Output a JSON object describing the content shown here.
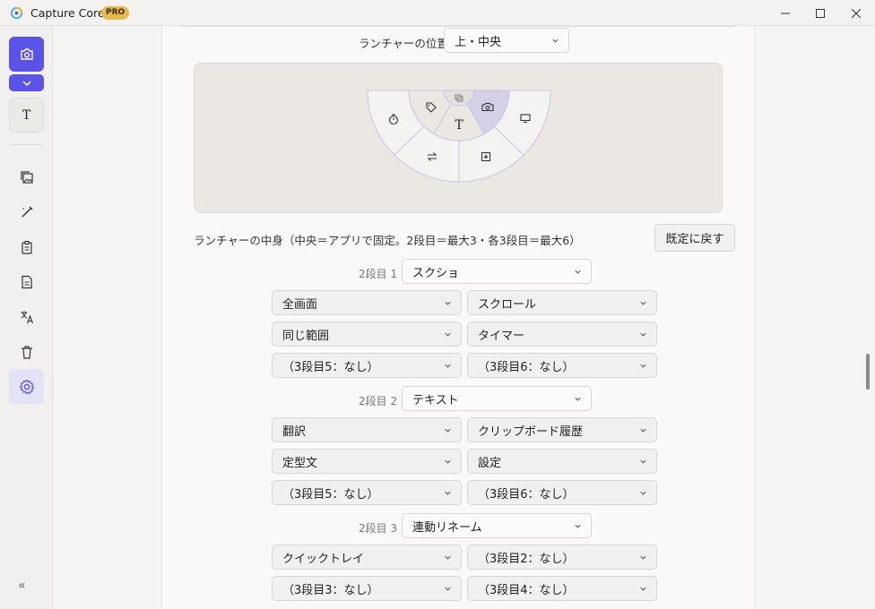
{
  "window": {
    "title": "Capture Core",
    "badge": "PRO",
    "controls": {
      "minimize": "—",
      "maximize": "☐",
      "close": "✕"
    }
  },
  "sidebar": {
    "primary_icon": "camera-icon",
    "text_tool_label": "T",
    "items": [
      {
        "name": "image-gallery",
        "icon": "images-icon"
      },
      {
        "name": "edit",
        "icon": "wand-icon"
      },
      {
        "name": "clipboard",
        "icon": "clipboard-icon"
      },
      {
        "name": "document",
        "icon": "document-icon"
      },
      {
        "name": "translate",
        "icon": "translate-icon"
      },
      {
        "name": "trash",
        "icon": "trash-icon"
      },
      {
        "name": "settings",
        "icon": "gear-icon",
        "active": true
      }
    ],
    "collapse_label": "«"
  },
  "launcher": {
    "position_label": "ランチャーの位置",
    "position_value": "上・中央",
    "preview": {
      "center_label": "T",
      "highlight_color": "#d3d0e8"
    },
    "contents_label": "ランチャーの中身（中央＝アプリで固定。2段目＝最大3・各3段目＝最大6）",
    "reset_label": "既定に戻す"
  },
  "groups": [
    {
      "label": "2段目 1",
      "value": "スクショ",
      "subs": [
        "全画面",
        "スクロール",
        "同じ範囲",
        "タイマー",
        "（3段目5：なし）",
        "（3段目6：なし）"
      ]
    },
    {
      "label": "2段目 2",
      "value": "テキスト",
      "subs": [
        "翻訳",
        "クリップボード履歴",
        "定型文",
        "設定",
        "（3段目5：なし）",
        "（3段目6：なし）"
      ]
    },
    {
      "label": "2段目 3",
      "value": "連動リネーム",
      "subs": [
        "クイックトレイ",
        "（3段目2：なし）",
        "（3段目3：なし）",
        "（3段目4：なし）"
      ]
    }
  ],
  "colors": {
    "accent": "#5b52e8",
    "badge": "#e6b94a"
  }
}
